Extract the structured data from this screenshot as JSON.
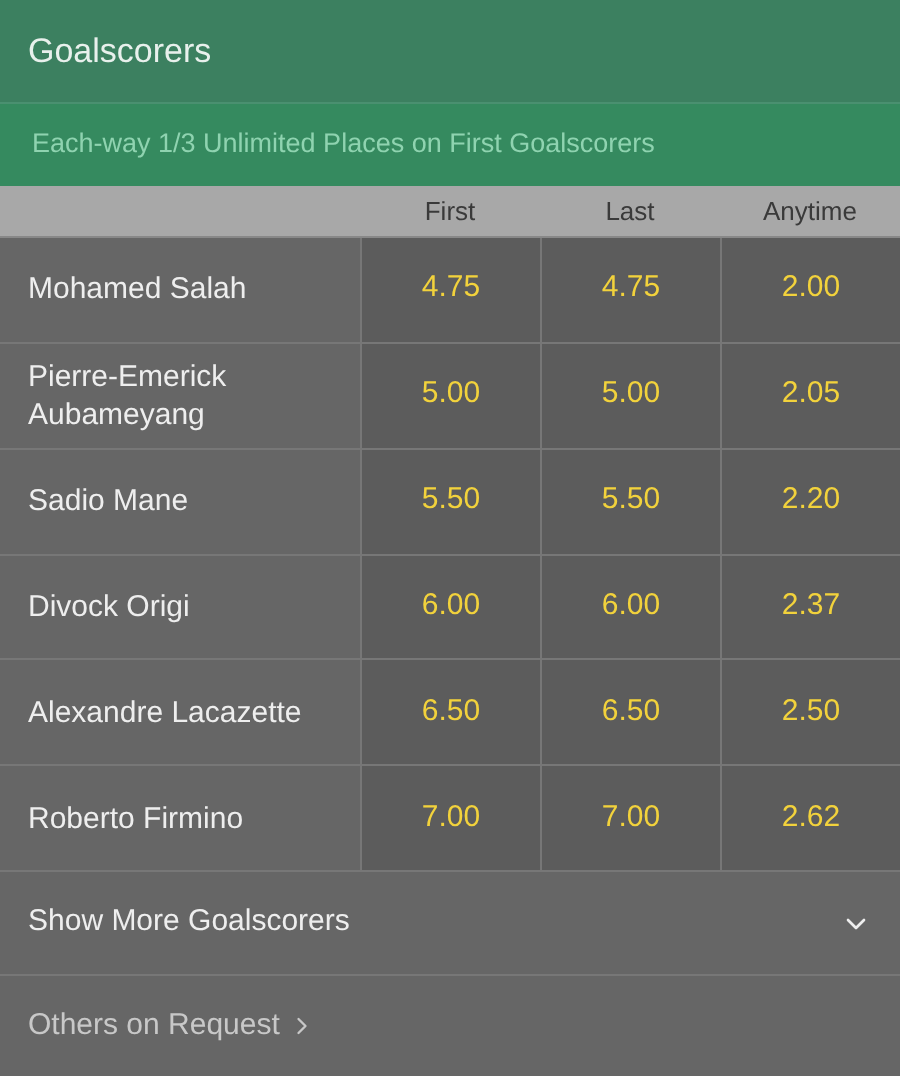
{
  "header": {
    "title": "Goalscorers",
    "subtitle": "Each-way 1/3 Unlimited Places on First Goalscorers"
  },
  "columns": [
    "First",
    "Last",
    "Anytime"
  ],
  "rows": [
    {
      "name": "Mohamed Salah",
      "odds": [
        "4.75",
        "4.75",
        "2.00"
      ]
    },
    {
      "name": "Pierre-Emerick Aubameyang",
      "odds": [
        "5.00",
        "5.00",
        "2.05"
      ]
    },
    {
      "name": "Sadio Mane",
      "odds": [
        "5.50",
        "5.50",
        "2.20"
      ]
    },
    {
      "name": "Divock Origi",
      "odds": [
        "6.00",
        "6.00",
        "2.37"
      ]
    },
    {
      "name": "Alexandre Lacazette",
      "odds": [
        "6.50",
        "6.50",
        "2.50"
      ]
    },
    {
      "name": "Roberto Firmino",
      "odds": [
        "7.00",
        "7.00",
        "2.62"
      ]
    }
  ],
  "show_more": {
    "label": "Show More Goalscorers",
    "expanded": false
  },
  "others_link": "Others on Request"
}
